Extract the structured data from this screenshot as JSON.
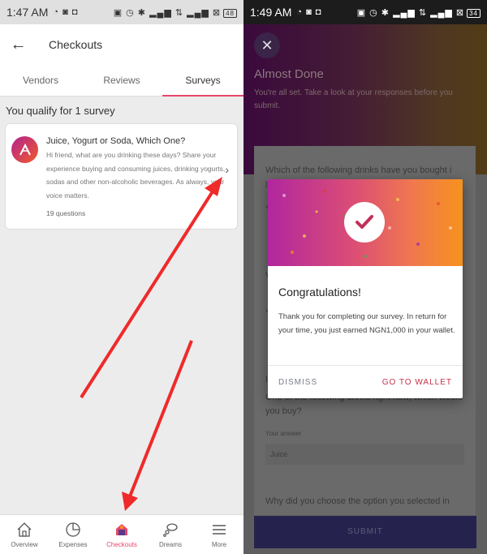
{
  "left": {
    "status": {
      "time": "1:47 AM",
      "battery": "48"
    },
    "appbar": {
      "title": "Checkouts"
    },
    "tabs": [
      {
        "label": "Vendors"
      },
      {
        "label": "Reviews"
      },
      {
        "label": "Surveys",
        "active": true
      }
    ],
    "qualify_text": "You qualify for 1 survey",
    "survey": {
      "title": "Juice, Yogurt or Soda, Which One?",
      "description": "Hi friend, what are you drinking these days? Share your experience buying and consuming juices, drinking yogurts, sodas and other non-alcoholic beverages. As always, your voice matters.",
      "questions": "19 questions"
    },
    "bottom_nav": [
      {
        "label": "Overview",
        "icon": "home-icon"
      },
      {
        "label": "Expenses",
        "icon": "pie-chart-icon"
      },
      {
        "label": "Checkouts",
        "icon": "checkouts-icon",
        "active": true
      },
      {
        "label": "Dreams",
        "icon": "dreams-icon"
      },
      {
        "label": "More",
        "icon": "menu-icon"
      }
    ]
  },
  "right": {
    "status": {
      "time": "1:49 AM",
      "battery": "34"
    },
    "hero": {
      "title": "Almost Done",
      "subtitle": "You're all set. Take a look at your responses before you submit."
    },
    "form": {
      "q1": "Which of the following drinks have you bought i",
      "q1_line2": "l",
      "q1_answer_hint": "Y",
      "q2_prefix": "V",
      "q2_answer_hint": "Y",
      "q3_prefix": "I",
      "q3_text": "One of the following drinks right now, which would you buy?",
      "q3_label": "Your answer",
      "q3_answer": "Juice",
      "q4": "Why did you choose the option you selected in"
    },
    "submit_label": "SUBMIT",
    "dialog": {
      "title": "Congratulations!",
      "body": "Thank you for completing our survey. In return for your time, you just earned NGN1,000 in your wallet.",
      "dismiss": "DISMISS",
      "go_to_wallet": "GO TO WALLET"
    }
  },
  "colors": {
    "accent": "#e8476b",
    "arrow": "#ef2a2a",
    "submit": "#25234e",
    "wallet_btn": "#c7304a"
  }
}
